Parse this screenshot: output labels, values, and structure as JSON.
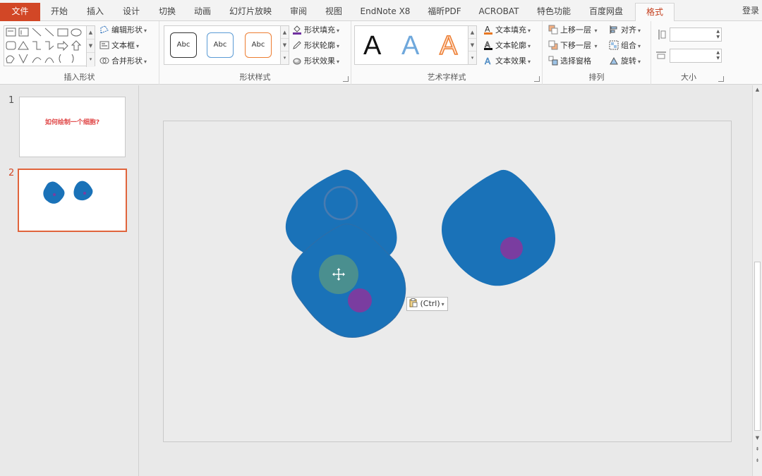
{
  "tabs": {
    "file": "文件",
    "items": [
      "开始",
      "插入",
      "设计",
      "切换",
      "动画",
      "幻灯片放映",
      "审阅",
      "视图",
      "EndNote X8",
      "福昕PDF",
      "ACROBAT",
      "特色功能",
      "百度网盘"
    ],
    "active": "格式",
    "login": "登录"
  },
  "ribbon": {
    "insert_shapes": {
      "label": "插入形状",
      "edit_shape": "编辑形状",
      "text_box": "文本框",
      "merge_shapes": "合并形状"
    },
    "shape_styles": {
      "label": "形状样式",
      "samples": [
        "Abc",
        "Abc",
        "Abc"
      ],
      "fill": "形状填充",
      "outline": "形状轮廓",
      "effects": "形状效果"
    },
    "wordart": {
      "label": "艺术字样式",
      "samples": [
        "A",
        "A",
        "A"
      ],
      "text_fill": "文本填充",
      "text_outline": "文本轮廓",
      "text_effects": "文本效果"
    },
    "arrange": {
      "label": "排列",
      "bring_forward": "上移一层",
      "send_backward": "下移一层",
      "selection_pane": "选择窗格",
      "align": "对齐",
      "group": "组合",
      "rotate": "旋转"
    },
    "size": {
      "label": "大小"
    }
  },
  "slides": [
    {
      "number": "1",
      "title": "如何绘制一个细胞?"
    },
    {
      "number": "2",
      "title": ""
    }
  ],
  "paste_options": "(Ctrl)",
  "colors": {
    "accent": "#d24726",
    "cell_blue": "#1a72b8",
    "nucleus_purple": "#7a3da0",
    "selected_teal": "#4a8f8f"
  }
}
